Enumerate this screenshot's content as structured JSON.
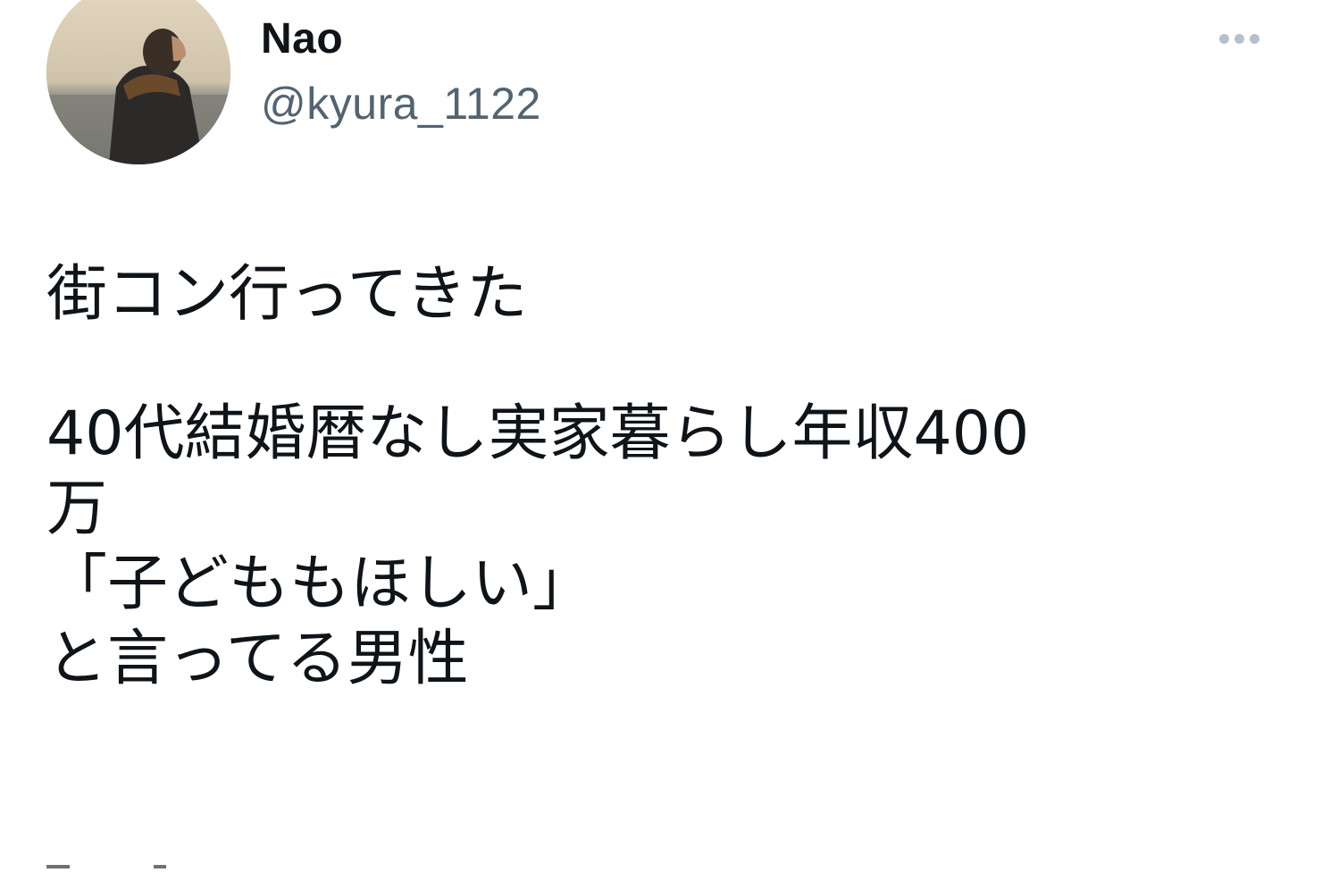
{
  "user": {
    "display_name": "Nao",
    "handle": "@kyura_1122"
  },
  "tweet": {
    "paragraphs": [
      "街コン行ってきた",
      "40代結婚暦なし実家暮らし年収400\n万\n「子どももほしい」\nと言ってる男性"
    ]
  },
  "icons": {
    "more": "more-horizontal-icon",
    "avatar": "profile-photo"
  },
  "colors": {
    "text": "#0f1419",
    "secondary": "#536471",
    "icon_gray": "#b6c0c8"
  }
}
